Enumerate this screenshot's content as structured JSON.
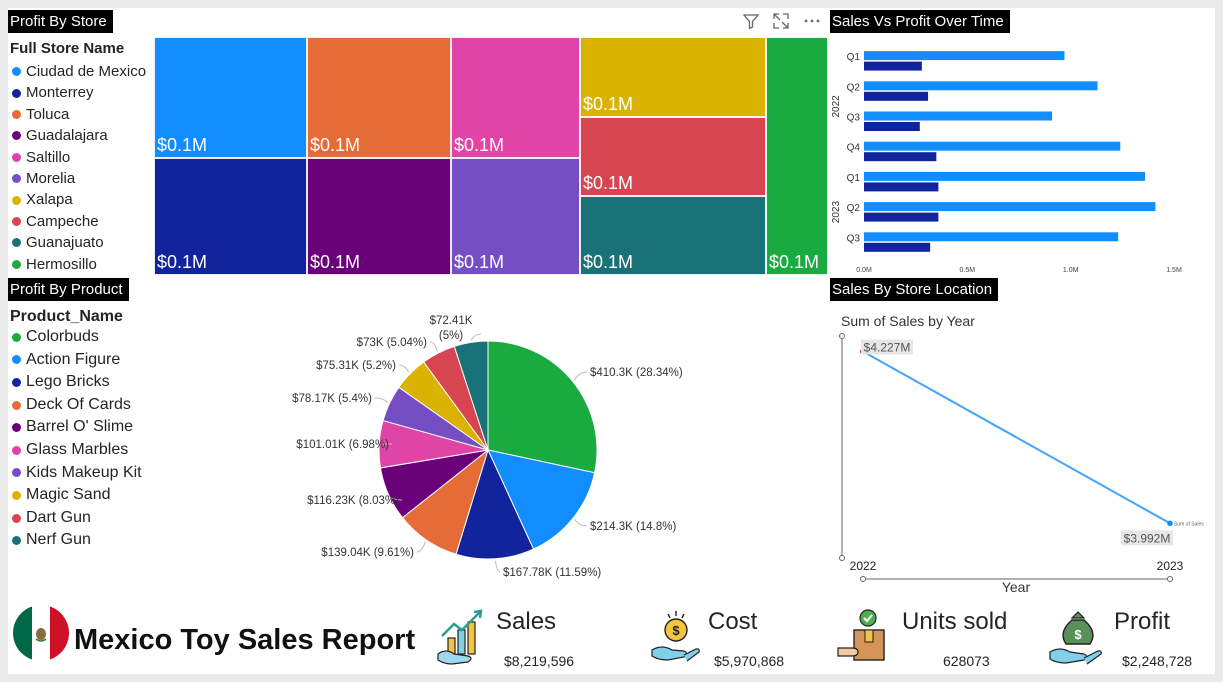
{
  "panels": {
    "treemap_title": "Profit By Store",
    "bar_title": "Sales Vs Profit Over Time",
    "pie_title": "Profit By Product",
    "line_title": "Sales By Store Location"
  },
  "store_legend": {
    "title": "Full Store Name",
    "items": [
      {
        "name": "Ciudad de Mexico",
        "color": "#118DFF"
      },
      {
        "name": "Monterrey",
        "color": "#12239E"
      },
      {
        "name": "Toluca",
        "color": "#E66C37"
      },
      {
        "name": "Guadalajara",
        "color": "#6B007B"
      },
      {
        "name": "Saltillo",
        "color": "#E044A7"
      },
      {
        "name": "Morelia",
        "color": "#744EC2"
      },
      {
        "name": "Xalapa",
        "color": "#D9B300"
      },
      {
        "name": "Campeche",
        "color": "#D64550"
      },
      {
        "name": "Guanajuato",
        "color": "#197278"
      },
      {
        "name": "Hermosillo",
        "color": "#1AAB40"
      }
    ]
  },
  "product_legend": {
    "title": "Product_Name",
    "items": [
      {
        "name": "Colorbuds",
        "color": "#1AAB40"
      },
      {
        "name": "Action Figure",
        "color": "#118DFF"
      },
      {
        "name": "Lego Bricks",
        "color": "#12239E"
      },
      {
        "name": "Deck Of Cards",
        "color": "#E66C37"
      },
      {
        "name": "Barrel O' Slime",
        "color": "#6B007B"
      },
      {
        "name": "Glass Marbles",
        "color": "#E044A7"
      },
      {
        "name": "Kids Makeup Kit",
        "color": "#744EC2"
      },
      {
        "name": "Magic Sand",
        "color": "#D9B300"
      },
      {
        "name": "Dart Gun",
        "color": "#D64550"
      },
      {
        "name": "Nerf Gun",
        "color": "#197278"
      }
    ]
  },
  "chart_data": [
    {
      "type": "treemap",
      "title": "Profit By Store",
      "cells": [
        {
          "store": "Ciudad de Mexico",
          "label": "$0.1M",
          "color": "#118DFF"
        },
        {
          "store": "Monterrey",
          "label": "$0.1M",
          "color": "#12239E"
        },
        {
          "store": "Toluca",
          "label": "$0.1M",
          "color": "#E66C37"
        },
        {
          "store": "Guadalajara",
          "label": "$0.1M",
          "color": "#6B007B"
        },
        {
          "store": "Saltillo",
          "label": "$0.1M",
          "color": "#E044A7"
        },
        {
          "store": "Morelia",
          "label": "$0.1M",
          "color": "#744EC2"
        },
        {
          "store": "Xalapa",
          "label": "$0.1M",
          "color": "#D9B300"
        },
        {
          "store": "Campeche",
          "label": "$0.1M",
          "color": "#D64550"
        },
        {
          "store": "Guanajuato",
          "label": "$0.1M",
          "color": "#197278"
        },
        {
          "store": "Hermosillo",
          "label": "$0.1M",
          "color": "#1AAB40"
        }
      ]
    },
    {
      "type": "bar",
      "orientation": "horizontal",
      "title": "Sales Vs Profit Over Time",
      "groups": [
        {
          "year": "2022",
          "quarters": [
            "Q1",
            "Q2",
            "Q3",
            "Q4"
          ]
        },
        {
          "year": "2023",
          "quarters": [
            "Q1",
            "Q2",
            "Q3"
          ]
        }
      ],
      "series": [
        {
          "color": "#118DFF",
          "values": [
            0.97,
            1.13,
            0.91,
            1.24,
            1.36,
            1.41,
            1.23
          ]
        },
        {
          "color": "#12239E",
          "values": [
            0.28,
            0.31,
            0.27,
            0.35,
            0.36,
            0.36,
            0.32
          ]
        }
      ],
      "xlim": [
        0,
        1.5
      ],
      "xticks": [
        "0.0M",
        "0.5M",
        "1.0M",
        "1.5M"
      ]
    },
    {
      "type": "pie",
      "title": "Profit By Product",
      "slices": [
        {
          "name": "Colorbuds",
          "value": 410.3,
          "label": "$410.3K (28.34%)",
          "color": "#1AAB40"
        },
        {
          "name": "Action Figure",
          "value": 214.3,
          "label": "$214.3K (14.8%)",
          "color": "#118DFF"
        },
        {
          "name": "Lego Bricks",
          "value": 167.78,
          "label": "$167.78K (11.59%)",
          "color": "#12239E"
        },
        {
          "name": "Deck Of Cards",
          "value": 139.04,
          "label": "$139.04K (9.61%)",
          "color": "#E66C37"
        },
        {
          "name": "Barrel O' Slime",
          "value": 116.23,
          "label": "$116.23K (8.03%)",
          "color": "#6B007B"
        },
        {
          "name": "Glass Marbles",
          "value": 101.01,
          "label": "$101.01K (6.98%)",
          "color": "#E044A7"
        },
        {
          "name": "Kids Makeup Kit",
          "value": 78.17,
          "label": "$78.17K (5.4%)",
          "color": "#744EC2"
        },
        {
          "name": "Magic Sand",
          "value": 75.31,
          "label": "$75.31K (5.2%)",
          "color": "#D9B300"
        },
        {
          "name": "Dart Gun",
          "value": 73.0,
          "label": "$73K (5.04%)",
          "color": "#D64550"
        },
        {
          "name": "Nerf Gun",
          "value": 72.41,
          "label": "$72.41K",
          "label2": "(5%)",
          "color": "#197278"
        }
      ]
    },
    {
      "type": "line",
      "title": "Sum of Sales by Year",
      "xlabel": "Year",
      "x": [
        "2022",
        "2023"
      ],
      "y": [
        4.227,
        3.992
      ],
      "labels": [
        "$4.227M",
        "$3.992M"
      ],
      "series_label": "Sum of Sales",
      "color": "#41A4FF",
      "point_colors": [
        "#C00000",
        "#118DFF"
      ]
    }
  ],
  "footer": {
    "report_title": "Mexico Toy Sales Report",
    "kpis": [
      {
        "label": "Sales",
        "value": "$8,219,596",
        "icon": "sales-growth-icon"
      },
      {
        "label": "Cost",
        "value": "$5,970,868",
        "icon": "coin-hand-icon"
      },
      {
        "label": "Units sold",
        "value": "628073",
        "icon": "package-check-icon"
      },
      {
        "label": "Profit",
        "value": "$2,248,728",
        "icon": "money-bag-hand-icon"
      }
    ]
  }
}
